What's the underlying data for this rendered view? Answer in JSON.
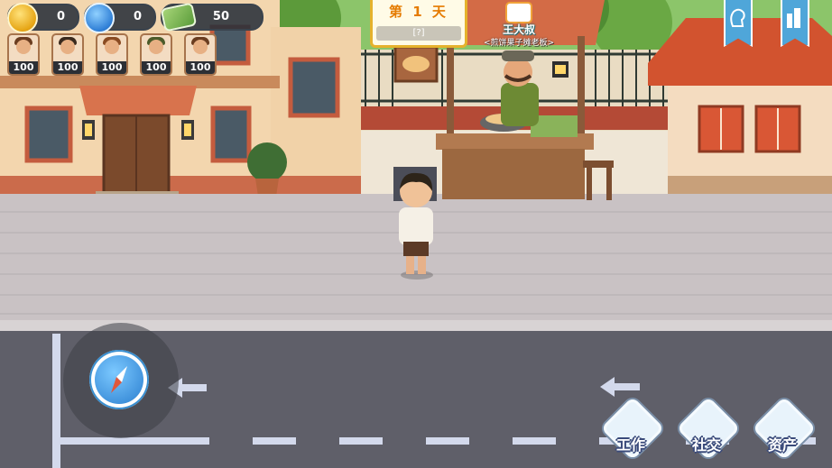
{
  "hud": {
    "coins": "0",
    "followers": "0",
    "cash": "50",
    "npc_counts": [
      "100",
      "100",
      "100",
      "100",
      "100"
    ]
  },
  "day": {
    "label": "第 1 天",
    "subtitle": "[?]"
  },
  "npc": {
    "name": "王大叔",
    "title": "<煎饼果子摊老板>"
  },
  "actions": {
    "work": "工作",
    "social": "社交",
    "assets": "资产"
  },
  "colors": {
    "road": "#5f5f69",
    "sidewalk": "#c9c2c4",
    "accent_blue": "#4fa6d9"
  },
  "icons": [
    "coin-icon",
    "user-icon",
    "cash-icon",
    "profile-ribbon-icon",
    "city-ribbon-icon",
    "compass-icon",
    "arrow-left-icon"
  ]
}
